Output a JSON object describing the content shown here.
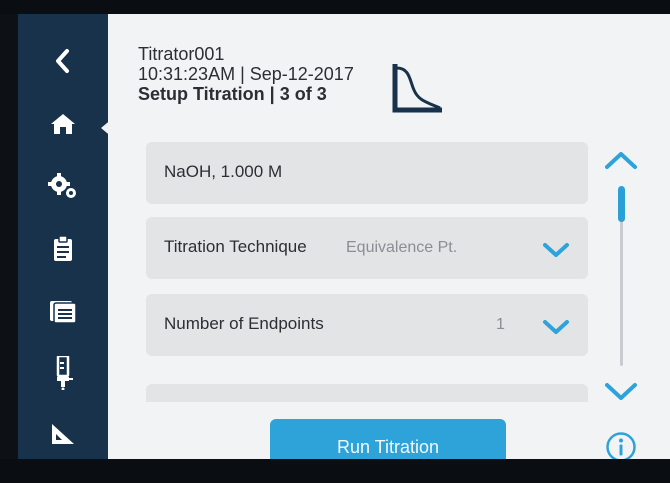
{
  "header": {
    "device_name": "Titrator001",
    "timestamp": "10:31:23AM | Sep-12-2017",
    "screen_title": "Setup Titration | 3 of 3"
  },
  "sidebar": {
    "items": [
      {
        "icon": "back-chevron-icon"
      },
      {
        "icon": "home-icon",
        "active": true
      },
      {
        "icon": "settings-gears-icon"
      },
      {
        "icon": "clipboard-icon"
      },
      {
        "icon": "files-icon"
      },
      {
        "icon": "burette-icon"
      },
      {
        "icon": "set-square-icon"
      }
    ]
  },
  "rows": [
    {
      "label": "NaOH, 1.000 M",
      "value": ""
    },
    {
      "label": "Titration Technique",
      "value": "Equivalence Pt."
    },
    {
      "label": "Number of Endpoints",
      "value": "1"
    }
  ],
  "actions": {
    "run_label": "Run Titration"
  },
  "colors": {
    "sidebar": "#17324a",
    "accent": "#2ea3da",
    "background": "#f2f3f4",
    "row": "#e2e4e6",
    "text": "#2b2f33"
  }
}
